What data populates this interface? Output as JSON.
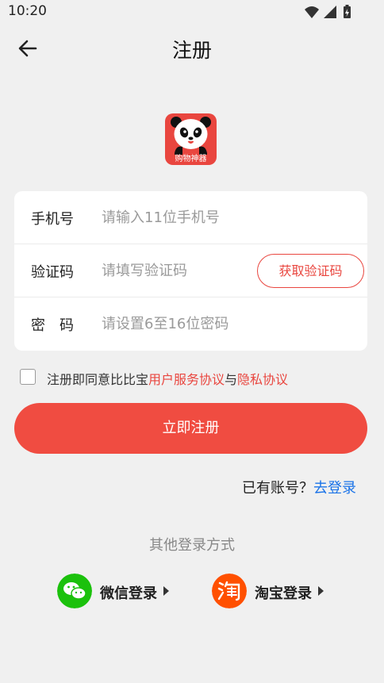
{
  "status_bar": {
    "time": "10:20",
    "icons": [
      "wifi-icon",
      "signal-icon",
      "battery-charging-icon"
    ]
  },
  "nav": {
    "title": "注册",
    "back_icon": "arrow-left-icon"
  },
  "app_logo": {
    "caption": "购物神器",
    "icon": "panda-logo-icon",
    "bg_color": "#e9463f"
  },
  "form": {
    "phone": {
      "label": "手机号",
      "placeholder": "请输入11位手机号",
      "value": ""
    },
    "code": {
      "label": "验证码",
      "placeholder": "请填写验证码",
      "value": "",
      "button": "获取验证码"
    },
    "password": {
      "label": "密　码",
      "placeholder": "请设置6至16位密码",
      "value": ""
    }
  },
  "agreement": {
    "checked": false,
    "prefix": "注册即同意比比宝",
    "service_link": "用户服务协议",
    "connector": "与",
    "privacy_link": "隐私协议"
  },
  "register_button": "立即注册",
  "login_prompt": {
    "text": "已有账号？",
    "link": "去登录"
  },
  "other_login": {
    "title": "其他登录方式",
    "wechat": {
      "label": "微信登录",
      "icon": "wechat-icon",
      "color": "#1bc10c"
    },
    "taobao": {
      "label": "淘宝登录",
      "icon": "taobao-icon",
      "color": "#ff5000"
    }
  },
  "colors": {
    "accent": "#e9463f",
    "link": "#1a73e8",
    "background": "#f0f0f0"
  }
}
